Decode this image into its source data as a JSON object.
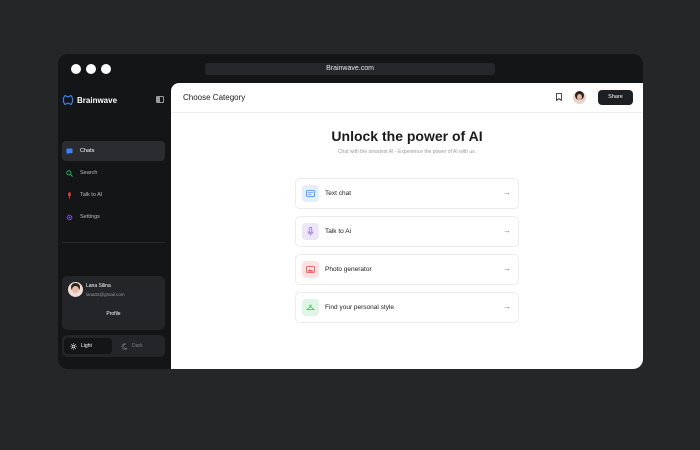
{
  "browser": {
    "url": "Brainwave.com"
  },
  "sidebar": {
    "brand": "Brainwave",
    "nav": [
      {
        "label": "Chats",
        "icon": "chat-icon",
        "color": "#3b82f6",
        "active": true
      },
      {
        "label": "Search",
        "icon": "search-icon",
        "color": "#22c55e",
        "active": false
      },
      {
        "label": "Talk to AI",
        "icon": "microphone-icon",
        "color": "#ef4444",
        "active": false
      },
      {
        "label": "Settings",
        "icon": "gear-icon",
        "color": "#8b5cf6",
        "active": false
      }
    ],
    "profile": {
      "name": "Lana Silina",
      "email": "lana02@gmail.com",
      "button": "Profile"
    },
    "theme": {
      "light": "Light",
      "dark": "Dark",
      "selected": "light"
    }
  },
  "header": {
    "title": "Choose Category",
    "share": "Share"
  },
  "hero": {
    "title": "Unlock the power of AI",
    "subtitle": "Chat with the smartest AI - Experience the power of AI with us."
  },
  "options": [
    {
      "label": "Text chat",
      "icon": "text-chat-icon",
      "bg": "#e3efff",
      "color": "#3b82f6"
    },
    {
      "label": "Talk to Ai",
      "icon": "microphone-icon",
      "bg": "#ece6f7",
      "color": "#8b5cf6"
    },
    {
      "label": "Photo generator",
      "icon": "image-icon",
      "bg": "#fde2e1",
      "color": "#ef4444"
    },
    {
      "label": "Find your personal style",
      "icon": "hanger-icon",
      "bg": "#dff6e6",
      "color": "#22c55e"
    }
  ],
  "colors": {
    "background": "#252628",
    "window": "#141517",
    "accent_dark": "#1e1f22"
  }
}
